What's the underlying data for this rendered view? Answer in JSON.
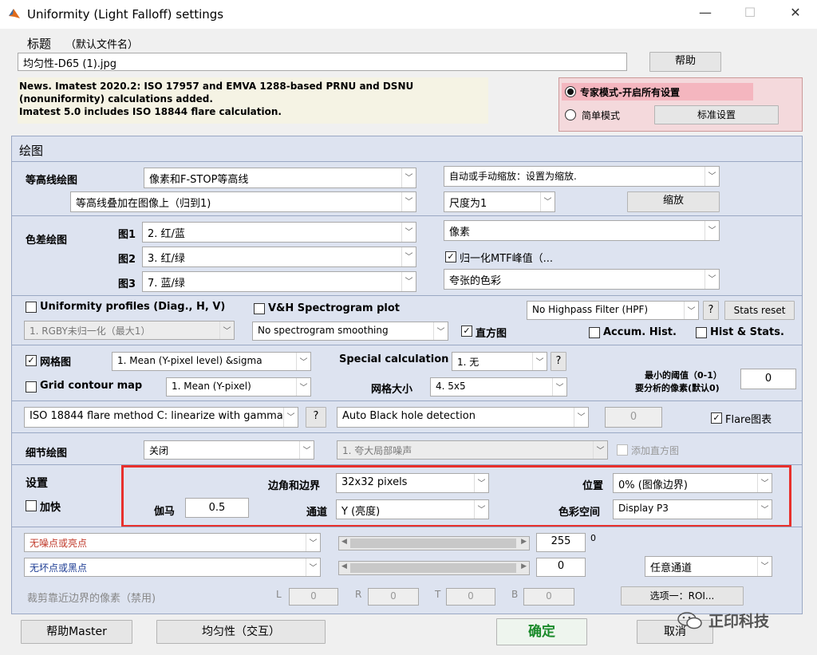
{
  "window": {
    "title": "Uniformity (Light Falloff) settings"
  },
  "header": {
    "title_label": "标题",
    "title_hint": "（默认文件名）",
    "title_value": "均匀性-D65 (1).jpg",
    "help": "帮助"
  },
  "news": {
    "l1": "News. Imatest 2020.2:  ISO 17957 and EMVA 1288-based PRNU and DSNU",
    "l2": "(nonuniformity) calculations added.",
    "l3": "Imatest 5.0 includes ISO 18844 flare calculation."
  },
  "mode": {
    "expert": "专家模式-开启所有设置",
    "simple": "简单模式",
    "standard": "标准设置"
  },
  "plot": {
    "heading": "绘图"
  },
  "contour": {
    "label": "等高线绘图",
    "type": "像素和F-STOP等高线",
    "overlay": "等高线叠加在图像上（归到1)",
    "zoom_mode": "自动或手动缩放：设置为缩放.",
    "scale": "尺度为1",
    "zoom_btn": "缩放"
  },
  "color": {
    "label": "色差绘图",
    "f1": "图1",
    "v1": "2.  红/蓝",
    "f2": "图2",
    "v2": "3.  红/绿",
    "f3": "图3",
    "v3": "7.  蓝/绿",
    "unit": "像素",
    "normalize": "归一化MTF峰值（...",
    "saturation": "夸张的色彩"
  },
  "profiles": {
    "label": "Uniformity profiles (Diag., H, V)",
    "norm": "1. RGBY未归一化（最大1）",
    "spectro": "V&H Spectrogram plot",
    "smoothing": "No  spectrogram smoothing",
    "histogram": "直方图",
    "hpf": "No Highpass Filter (HPF)",
    "q": "?",
    "stats_reset": "Stats reset",
    "accum": "Accum. Hist.",
    "hist_stats": "Hist & Stats."
  },
  "grid": {
    "label": "网格图",
    "mean": "1.  Mean (Y-pixel level) &sigma",
    "contour": "Grid contour map",
    "contour_val": "1.  Mean (Y-pixel)",
    "special": "Special calculation",
    "special_val": "1. 无",
    "q": "?",
    "size_label": "网格大小",
    "size_val": "4.   5x5",
    "thresh_l1": "最小的阈值（0-1）",
    "thresh_l2": "要分析的像素(默认0)",
    "thresh_val": "0"
  },
  "flare": {
    "method": "ISO 18844 flare method C: linearize with gamma",
    "q": "?",
    "blackhole": "Auto Black hole detection",
    "value": "0",
    "chart": "Flare图表"
  },
  "detail": {
    "label": "细节绘图",
    "value": "关闭",
    "noise": "1.   夸大局部噪声",
    "add_hist": "添加直方图"
  },
  "settings": {
    "label": "设置",
    "speed": "加快",
    "gamma_label": "伽马",
    "gamma": "0.5",
    "corner_label": "边角和边界",
    "corner": "32x32 pixels",
    "channel_label": "通道",
    "channel": "Y (亮度)",
    "pos_label": "位置",
    "pos": "0% (图像边界)",
    "cs_label": "色彩空间",
    "cs": "Display P3"
  },
  "pixels": {
    "hot": "无噪点或亮点",
    "hot_val": "255",
    "zero": "0",
    "dead": "无坏点或黑点",
    "dead_val": "0",
    "any_channel": "任意通道"
  },
  "crop": {
    "label": "裁剪靠近边界的像素（禁用)",
    "L": "L",
    "Lv": "0",
    "R": "R",
    "Rv": "0",
    "T": "T",
    "Tv": "0",
    "B": "B",
    "Bv": "0",
    "roi": "选项一：ROI..."
  },
  "footer": {
    "help_master": "帮助Master",
    "uniformity": "均匀性（交互）",
    "ok": "确定",
    "cancel": "取消",
    "watermark": "正印科技"
  },
  "colors": {
    "highlight": "#e8302c",
    "ok_green": "#1a8a2a",
    "mode_bg": "#f4d9dc"
  }
}
